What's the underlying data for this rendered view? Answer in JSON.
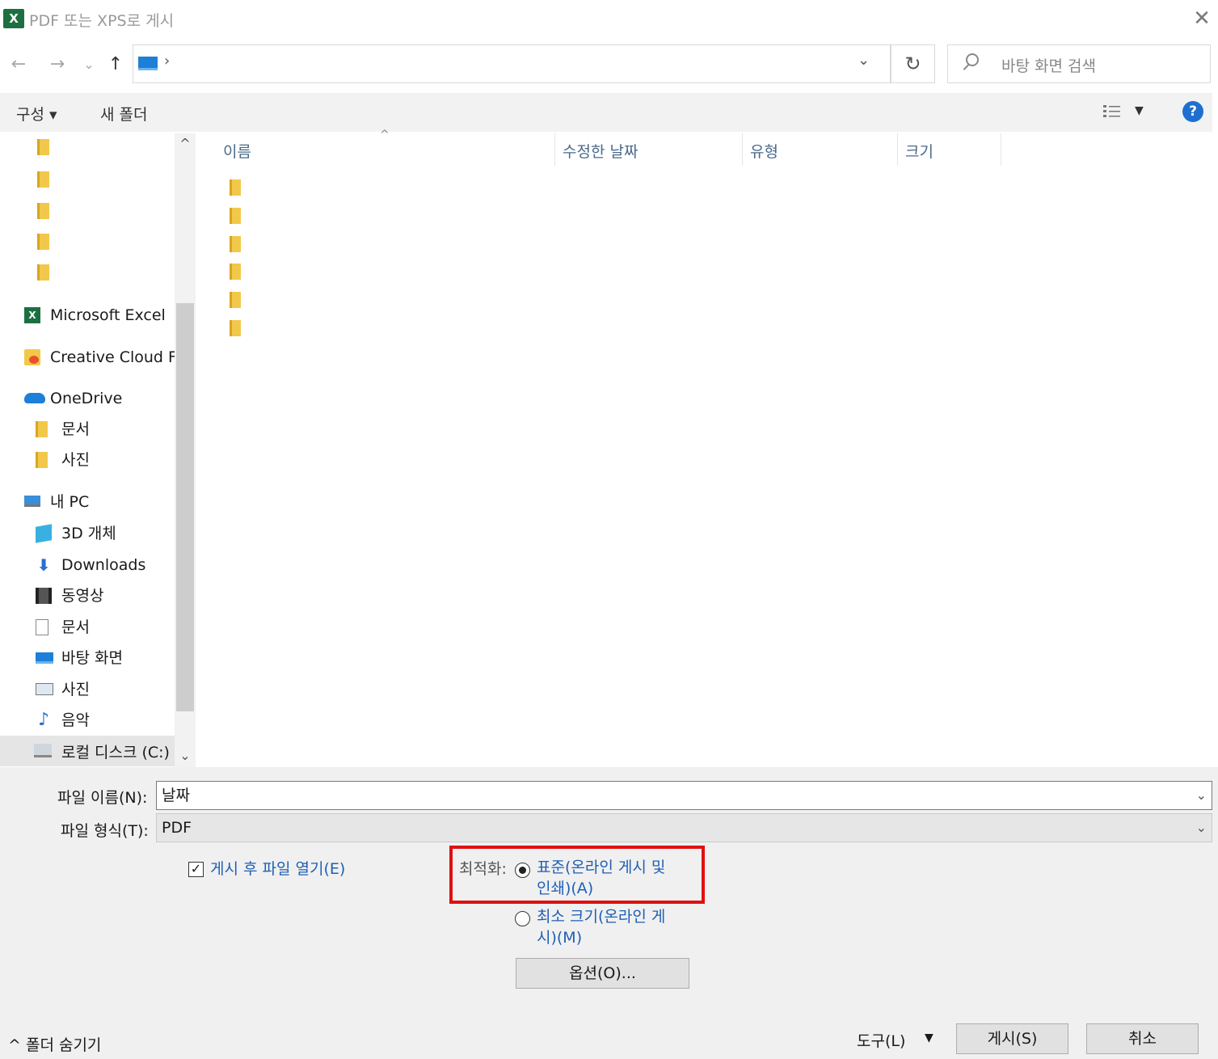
{
  "window": {
    "title": "PDF 또는 XPS로 게시",
    "app_icon_letter": "X"
  },
  "nav": {
    "back": "←",
    "forward": "→",
    "recent": "⌄",
    "up": "↑",
    "address_separator": "›",
    "address_dropdown": "⌄",
    "refresh": "↻",
    "search_placeholder": "바탕 화면 검색"
  },
  "toolbar": {
    "organize": "구성 ▾",
    "new_folder": "새 폴더",
    "view_dropdown": "▼",
    "help": "?"
  },
  "navpane": {
    "pinned_folders": [
      "",
      "",
      "",
      "",
      ""
    ],
    "items": [
      {
        "label": "Microsoft Excel",
        "icon": "excel-icon"
      },
      {
        "label": "Creative Cloud Fil",
        "icon": "creative-cloud-icon"
      },
      {
        "label": "OneDrive",
        "icon": "onedrive-icon"
      },
      {
        "label": "문서",
        "icon": "folder-icon"
      },
      {
        "label": "사진",
        "icon": "folder-icon"
      },
      {
        "label": "내 PC",
        "icon": "pc-icon"
      },
      {
        "label": "3D 개체",
        "icon": "3d-objects-icon"
      },
      {
        "label": "Downloads",
        "icon": "download-icon"
      },
      {
        "label": "동영상",
        "icon": "video-icon"
      },
      {
        "label": "문서",
        "icon": "document-icon"
      },
      {
        "label": "바탕 화면",
        "icon": "desktop-icon"
      },
      {
        "label": "사진",
        "icon": "picture-icon"
      },
      {
        "label": "음악",
        "icon": "music-icon"
      },
      {
        "label": "로컬 디스크 (C:)",
        "icon": "drive-icon"
      }
    ]
  },
  "filelist": {
    "columns": [
      "이름",
      "수정한 날짜",
      "유형",
      "크기"
    ],
    "folder_rows": 6
  },
  "form": {
    "filename_label": "파일 이름(N):",
    "filename_value": "날짜",
    "filetype_label": "파일 형식(T):",
    "filetype_value": "PDF",
    "open_after_publish": "게시 후 파일 열기(E)",
    "open_after_publish_checked": true,
    "optimize_label": "최적화:",
    "optimize_standard_line1": "표준(온라인 게시 및",
    "optimize_standard_line2": "인쇄)(A)",
    "optimize_minimum_line1": "최소 크기(온라인 게",
    "optimize_minimum_line2": "시)(M)",
    "options_button": "옵션(O)...",
    "selected_optimization": "standard"
  },
  "footer": {
    "hide_folders": "^ 폴더 숨기기",
    "tools": "도구(L)",
    "tools_drop": "▼",
    "publish": "게시(S)",
    "cancel": "취소"
  },
  "colors": {
    "accent_blue": "#1e5fb4",
    "highlight_red": "#e01010",
    "excel_green": "#1d6f42"
  }
}
